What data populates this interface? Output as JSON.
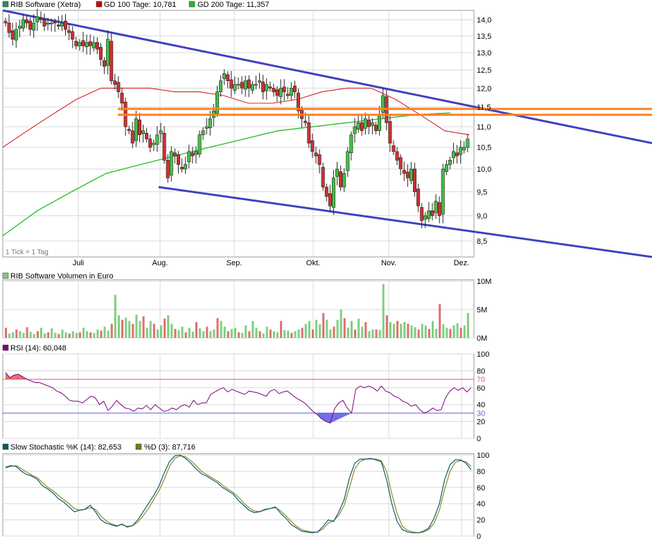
{
  "legends": {
    "main": [
      {
        "label": "RIB Software (Xetra)",
        "color": "#2e8b57"
      },
      {
        "label": "GD 100 Tage: 10,781",
        "color": "#d00000"
      },
      {
        "label": "GD 200 Tage: 11,357",
        "color": "#22bb22"
      }
    ],
    "volume": {
      "label": "RIB Software Volumen in Euro",
      "color": "#7ec87e"
    },
    "rsi": {
      "label": "RSI (14): 60,048",
      "color": "#800080"
    },
    "stoch": [
      {
        "label": "Slow Stochastic %K (14): 82,653",
        "color": "#0b5c6b"
      },
      {
        "label": "%D (3): 87,716",
        "color": "#7a7a1a"
      }
    ],
    "tick_note": "1 Tick = 1 Tag"
  },
  "colors": {
    "up_candle": "#44c044",
    "down_candle": "#d03030",
    "trendline": "#4040c0",
    "resistance": "#ff8020",
    "gd100": "#d02020",
    "gd200": "#22bb22",
    "rsi_line": "#800080",
    "rsi_overbought": "#e06060",
    "rsi_oversold": "#6060e0",
    "stoch_k": "#0b5c6b",
    "stoch_d": "#8a8a20",
    "grid": "#d8d8d8"
  },
  "chart_data": [
    {
      "type": "candlestick",
      "title": "RIB Software (Xetra)",
      "x_labels": [
        "Juli",
        "Aug.",
        "Sep.",
        "Okt.",
        "Nov.",
        "Dez."
      ],
      "y_ticks": [
        "14,0",
        "13,5",
        "13,0",
        "12,5",
        "12,0",
        "11,5",
        "11,0",
        "10,5",
        "10,0",
        "9,5",
        "9,0",
        "8,5"
      ],
      "y_tick_values": [
        14.0,
        13.5,
        13.0,
        12.5,
        12.0,
        11.5,
        11.0,
        10.5,
        10.0,
        9.5,
        9.0,
        8.5
      ],
      "scale": "log",
      "ylim": [
        8.2,
        14.3
      ],
      "candles_close": [
        13.9,
        13.6,
        13.4,
        13.7,
        13.8,
        14.0,
        13.9,
        13.7,
        13.9,
        14.1,
        14.0,
        13.8,
        13.9,
        13.9,
        13.9,
        13.8,
        13.9,
        13.7,
        13.6,
        13.4,
        13.2,
        13.3,
        13.2,
        13.3,
        13.2,
        13.3,
        13.1,
        12.8,
        12.6,
        13.4,
        12.2,
        12.1,
        11.9,
        11.6,
        11.0,
        10.9,
        10.6,
        11.2,
        10.8,
        10.9,
        10.7,
        10.5,
        10.6,
        10.8,
        10.9,
        10.2,
        9.8,
        10.4,
        10.3,
        10.1,
        10.0,
        10.1,
        10.4,
        10.3,
        10.4,
        10.8,
        10.9,
        11.0,
        11.2,
        11.4,
        11.9,
        12.2,
        12.4,
        12.2,
        12.0,
        12.1,
        12.1,
        12.0,
        12.2,
        12.0,
        12.1,
        12.1,
        12.2,
        11.9,
        12.1,
        12.0,
        11.9,
        11.8,
        12.0,
        11.9,
        11.8,
        12.0,
        11.9,
        11.4,
        11.2,
        11.1,
        10.6,
        10.4,
        10.3,
        10.1,
        9.6,
        9.4,
        9.2,
        9.8,
        10.0,
        9.6,
        9.9,
        10.4,
        10.8,
        11.0,
        11.1,
        10.9,
        11.2,
        11.0,
        11.1,
        10.9,
        11.3,
        11.8,
        11.1,
        10.6,
        10.4,
        10.2,
        10.0,
        9.9,
        9.8,
        10.0,
        9.5,
        9.2,
        8.9,
        9.0,
        9.1,
        9.0,
        9.3,
        9.0,
        10.0,
        10.1,
        10.2,
        10.4,
        10.3,
        10.5,
        10.5,
        10.7
      ],
      "gd100": [
        10.5,
        10.9,
        11.3,
        11.7,
        12.0,
        12.0,
        12.0,
        11.9,
        11.9,
        11.8,
        11.6,
        11.6,
        11.7,
        11.9,
        12.0,
        12.0,
        11.7,
        11.3,
        10.9,
        10.8
      ],
      "gd200": [
        8.6,
        9.1,
        9.5,
        9.9,
        10.1,
        10.3,
        10.5,
        10.7,
        10.9,
        11.0,
        11.1,
        11.2,
        11.3,
        11.35
      ],
      "trendline_upper": [
        [
          0,
          14.3
        ],
        [
          1,
          10.6
        ]
      ],
      "trendline_lower": [
        [
          0.24,
          9.6
        ],
        [
          1,
          8.2
        ]
      ],
      "resistance_levels": [
        11.45,
        11.3
      ]
    },
    {
      "type": "bar",
      "title": "RIB Software Volumen in Euro",
      "y_ticks": [
        "10M",
        "5M",
        "0M"
      ],
      "ylim": [
        0,
        10000000
      ],
      "values_millions": [
        1.8,
        0.8,
        1.0,
        1.5,
        1.2,
        0.9,
        1.9,
        1.1,
        0.7,
        1.2,
        1.8,
        0.8,
        1.0,
        1.7,
        0.9,
        0.7,
        1.5,
        1.0,
        0.8,
        1.2,
        0.9,
        1.0,
        1.8,
        1.2,
        1.0,
        0.9,
        1.5,
        1.3,
        2.0,
        1.3,
        2.5,
        7.6,
        4.0,
        3.2,
        3.6,
        3.0,
        2.5,
        4.1,
        3.0,
        3.8,
        1.8,
        3.0,
        2.5,
        1.5,
        2.2,
        3.4,
        4.0,
        2.5,
        1.6,
        1.4,
        2.0,
        1.0,
        1.8,
        1.1,
        2.8,
        1.7,
        1.2,
        2.0,
        1.2,
        1.5,
        3.5,
        3.0,
        2.0,
        1.2,
        1.6,
        1.8,
        1.0,
        0.9,
        2.2,
        1.2,
        3.0,
        1.8,
        1.2,
        0.8,
        2.0,
        1.5,
        1.2,
        1.0,
        3.0,
        1.4,
        1.3,
        0.9,
        1.2,
        1.5,
        1.8,
        2.5,
        3.0,
        1.5,
        3.2,
        2.4,
        4.4,
        3.2,
        1.5,
        2.0,
        3.2,
        5.0,
        3.5,
        1.8,
        3.0,
        1.5,
        3.4,
        2.0,
        2.8,
        1.2,
        1.5,
        1.5,
        1.4,
        9.5,
        4.0,
        2.8,
        2.5,
        3.0,
        2.5,
        2.8,
        2.5,
        2.2,
        1.9,
        1.5,
        2.5,
        2.2,
        1.6,
        3.0,
        1.6,
        6.0,
        2.4,
        1.8,
        1.6,
        2.2,
        2.6,
        1.8,
        2.2,
        4.4
      ],
      "up_mask_seed": 7
    },
    {
      "type": "line",
      "title": "RSI (14): 60,048",
      "y_ticks": [
        "100",
        "80",
        "70",
        "60",
        "40",
        "30",
        "20",
        "0"
      ],
      "y_tick_values": [
        100,
        80,
        70,
        60,
        40,
        30,
        20,
        0
      ],
      "ylim": [
        0,
        100
      ],
      "overbought": 70,
      "oversold": 30,
      "values": [
        78,
        72,
        75,
        76,
        73,
        70,
        68,
        66,
        66,
        64,
        62,
        60,
        56,
        54,
        50,
        45,
        44,
        44,
        42,
        46,
        50,
        48,
        40,
        44,
        33,
        38,
        45,
        40,
        36,
        35,
        32,
        36,
        35,
        39,
        34,
        40,
        36,
        32,
        33,
        36,
        34,
        38,
        40,
        37,
        45,
        40,
        42,
        42,
        52,
        55,
        58,
        60,
        55,
        58,
        56,
        54,
        52,
        56,
        55,
        54,
        52,
        50,
        56,
        58,
        53,
        55,
        56,
        52,
        48,
        45,
        42,
        37,
        32,
        28,
        23,
        20,
        18,
        35,
        42,
        45,
        36,
        30,
        58,
        62,
        60,
        62,
        60,
        56,
        62,
        56,
        54,
        50,
        48,
        44,
        42,
        38,
        40,
        34,
        30,
        32,
        36,
        33,
        34,
        48,
        56,
        60,
        57,
        60,
        55,
        60
      ]
    },
    {
      "type": "line",
      "title": "Slow Stochastic",
      "y_ticks": [
        "100",
        "80",
        "60",
        "40",
        "20",
        "0"
      ],
      "y_tick_values": [
        100,
        80,
        60,
        40,
        20,
        0
      ],
      "ylim": [
        0,
        100
      ],
      "k_values": [
        85,
        87,
        86,
        80,
        76,
        74,
        70,
        62,
        58,
        53,
        46,
        42,
        36,
        30,
        32,
        33,
        38,
        30,
        20,
        16,
        14,
        12,
        15,
        11,
        13,
        20,
        30,
        40,
        50,
        62,
        78,
        92,
        99,
        100,
        96,
        90,
        83,
        77,
        74,
        70,
        66,
        60,
        56,
        52,
        44,
        38,
        32,
        29,
        30,
        33,
        34,
        36,
        28,
        22,
        14,
        10,
        6,
        5,
        4,
        5,
        12,
        20,
        18,
        30,
        45,
        72,
        90,
        95,
        95,
        96,
        94,
        92,
        70,
        40,
        18,
        8,
        5,
        4,
        4,
        6,
        10,
        22,
        40,
        70,
        88,
        94,
        94,
        90,
        82
      ],
      "d_values": [
        84,
        86,
        87,
        83,
        79,
        75,
        72,
        66,
        60,
        56,
        50,
        45,
        40,
        34,
        32,
        33,
        35,
        33,
        25,
        19,
        15,
        13,
        14,
        12,
        13,
        17,
        25,
        34,
        45,
        56,
        70,
        86,
        96,
        99,
        98,
        93,
        87,
        80,
        76,
        72,
        68,
        63,
        58,
        54,
        48,
        41,
        35,
        31,
        30,
        32,
        34,
        35,
        31,
        25,
        18,
        12,
        8,
        6,
        5,
        5,
        9,
        16,
        19,
        26,
        38,
        60,
        83,
        92,
        95,
        95,
        95,
        93,
        80,
        52,
        28,
        12,
        7,
        5,
        4,
        5,
        8,
        16,
        32,
        58,
        80,
        91,
        93,
        92,
        86
      ]
    }
  ],
  "x_labels": [
    "Juli",
    "Aug.",
    "Sep.",
    "Okt.",
    "Nov.",
    "Dez."
  ]
}
